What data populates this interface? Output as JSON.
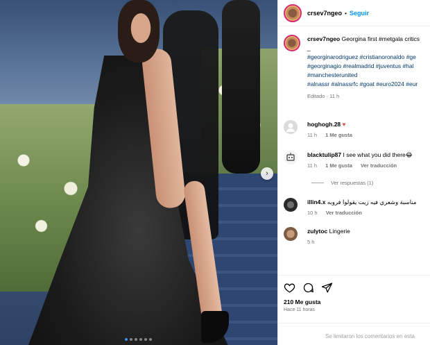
{
  "post": {
    "username": "crsev7ngeo",
    "separator": "•",
    "follow_label": "Seguir",
    "caption_lines": [
      "Georgina first #metgala critics",
      "_",
      "#georginarodriguez #cristianoronaldo #ge",
      "#georginagio #realmadrid #juventus #hal",
      "#manchesterunited",
      "#alnassr #alnassrfc #goat #euro2024 #eur"
    ],
    "caption_meta": "Editado · 11 h"
  },
  "comments": [
    {
      "user": "hoghogh.28",
      "text": "♥",
      "time": "11 h",
      "likes": "1 Me gusta",
      "reply": ""
    },
    {
      "user": "blacktulip87",
      "text": "I see what you did there😂",
      "time": "11 h",
      "likes": "1 Me gusta",
      "reply": "Ver traducción"
    },
    {
      "user": "illin4.x",
      "text": "مناسبة وشعري فيه زيت يقولوا فروبه",
      "time": "10 h",
      "likes": "",
      "reply": "Ver traducción"
    },
    {
      "user": "zulytoc",
      "text": "Lingerie",
      "time": "5 h",
      "likes": "",
      "reply": ""
    }
  ],
  "view_replies": "Ver respuestas (1)",
  "actions": {
    "likes": "210 Me gusta",
    "when": "Hace 11 horas",
    "comments_closed": "Se limitaron los comentarios en esta"
  },
  "carousel": {
    "slides": 6,
    "active": 0
  },
  "colors": {
    "accent": "#0095f6",
    "hashtag": "#00376b",
    "muted": "#737373",
    "heart": "#ed4956"
  }
}
